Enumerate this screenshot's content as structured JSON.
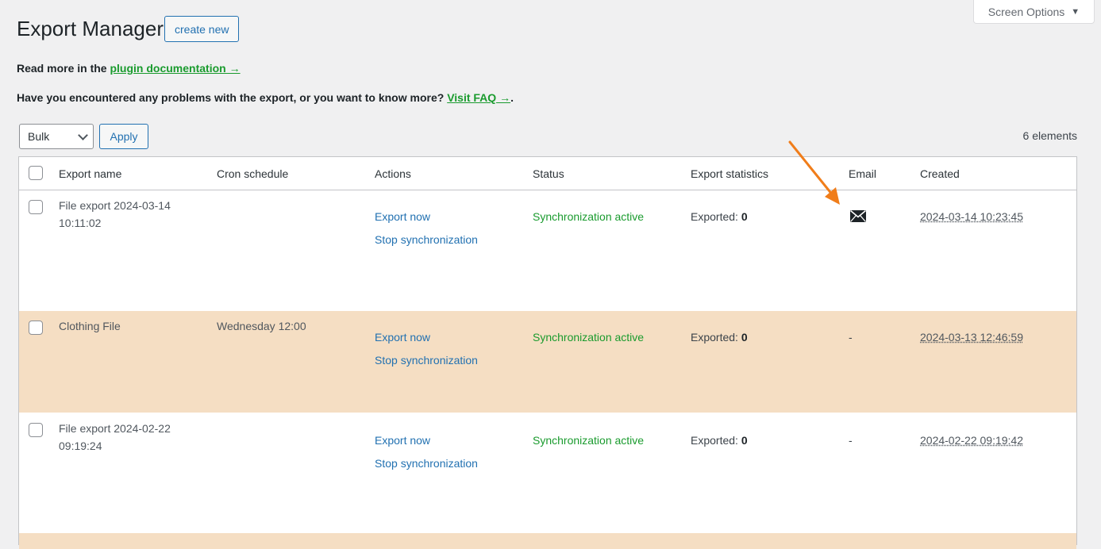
{
  "header": {
    "title": "Export Manager",
    "create_label": "create new",
    "screen_options": "Screen Options"
  },
  "info": {
    "docs_prefix": "Read more in the",
    "docs_link": "plugin documentation →",
    "faq_prefix": "Have you encountered any problems with the export, or you want to know more?",
    "faq_link": "Visit FAQ →",
    "faq_suffix": "."
  },
  "toolbar": {
    "bulk_value": "Bulk",
    "apply_label": "Apply",
    "count_text": "6 elements"
  },
  "table": {
    "columns": [
      "Export name",
      "Cron schedule",
      "Actions",
      "Status",
      "Export statistics",
      "Email",
      "Created"
    ],
    "rows": [
      {
        "name_line1": "File export 2024-03-14",
        "name_line2": "10:11:02",
        "cron": "",
        "action_export": "Export now",
        "action_stop": "Stop synchronization",
        "status": "Synchronization active",
        "stat_label": "Exported:",
        "stat_value": "0",
        "email": "",
        "email_icon": "envelope-icon",
        "created": "2024-03-14 10:23:45"
      },
      {
        "name_line1": "Clothing File",
        "name_line2": "",
        "cron": "Wednesday 12:00",
        "action_export": "Export now",
        "action_stop": "Stop synchronization",
        "status": "Synchronization active",
        "stat_label": "Exported:",
        "stat_value": "0",
        "email": "-",
        "created": "2024-03-13 12:46:59"
      },
      {
        "name_line1": "File export 2024-02-22",
        "name_line2": "09:19:24",
        "cron": "",
        "action_export": "Export now",
        "action_stop": "Stop synchronization",
        "status": "Synchronization active",
        "stat_label": "Exported:",
        "stat_value": "0",
        "email": "-",
        "created": "2024-02-22 09:19:42"
      }
    ]
  },
  "colors": {
    "accent": "#2271b1",
    "success": "#1a9b2e",
    "highlight_row": "#f5dec3",
    "annotation_arrow": "#f07d1a"
  }
}
